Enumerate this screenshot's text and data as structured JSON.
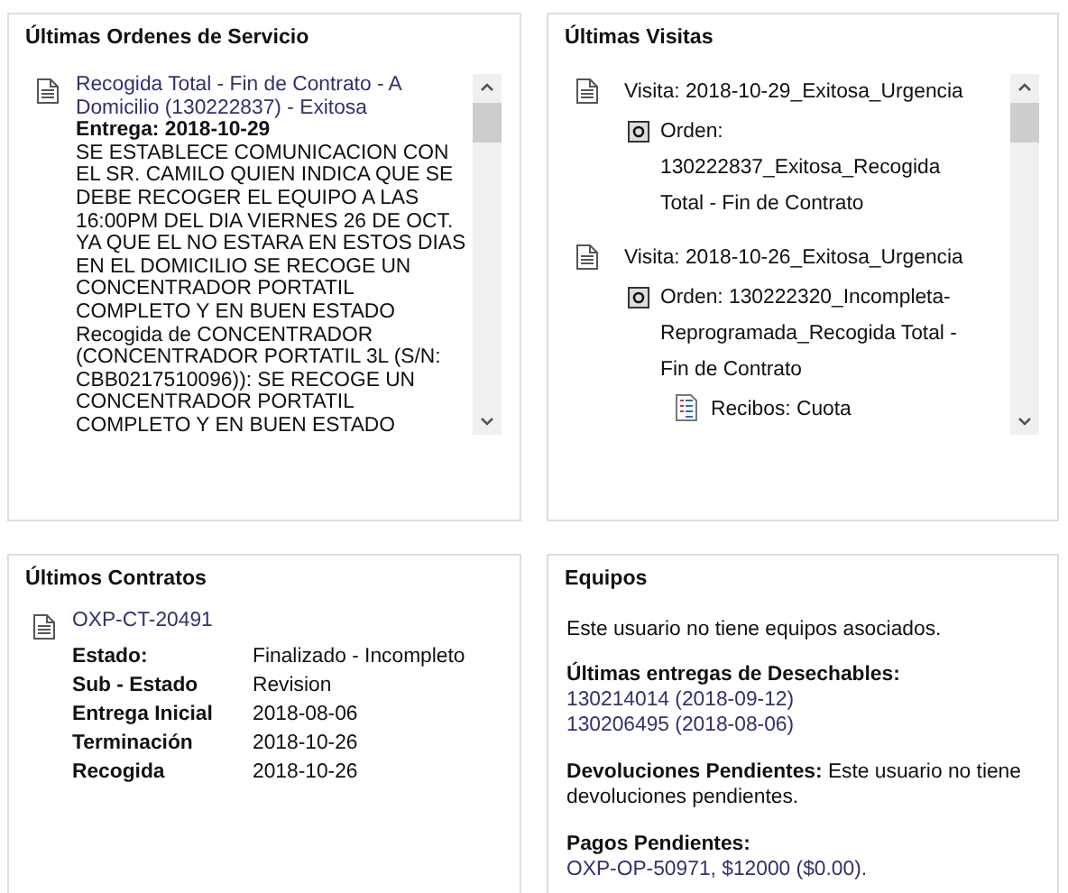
{
  "orders_panel": {
    "title": "Últimas Ordenes de Servicio",
    "orders": [
      {
        "title": "Recogida Total - Fin de Contrato - A Domicilio (130222837) - Exitosa",
        "delivery": "Entrega: 2018-10-29",
        "description": "SE ESTABLECE COMUNICACION CON EL SR. CAMILO QUIEN INDICA QUE SE DEBE RECOGER EL EQUIPO A LAS 16:00PM DEL DIA VIERNES 26 DE OCT. YA QUE EL NO ESTARA EN ESTOS DIAS EN EL DOMICILIO SE RECOGE UN CONCENTRADOR PORTATIL COMPLETO Y EN BUEN ESTADO Recogida de CONCENTRADOR (CONCENTRADOR PORTATIL 3L (S/N: CBB0217510096)): SE RECOGE UN CONCENTRADOR PORTATIL COMPLETO Y EN BUEN ESTADO"
      }
    ]
  },
  "visits_panel": {
    "title": "Últimas Visitas",
    "visits": [
      {
        "kind": "visit",
        "label": "Visita: 2018-10-29_Exitosa_Urgencia",
        "children": [
          {
            "kind": "order",
            "label": "Orden: 130222837_Exitosa_Recogida Total - Fin de Contrato"
          }
        ]
      },
      {
        "kind": "visit",
        "label": "Visita: 2018-10-26_Exitosa_Urgencia",
        "children": [
          {
            "kind": "order",
            "label": "Orden: 130222320_Incompleta-Reprogramada_Recogida Total - Fin de Contrato",
            "children": [
              {
                "kind": "receipt",
                "label": "Recibos: Cuota"
              }
            ]
          }
        ]
      }
    ]
  },
  "contracts_panel": {
    "title": "Últimos Contratos",
    "contracts": [
      {
        "id": "OXP-CT-20491",
        "fields": [
          {
            "label": "Estado:",
            "value": "Finalizado - Incompleto"
          },
          {
            "label": "Sub - Estado",
            "value": "Revision"
          },
          {
            "label": "Entrega Inicial",
            "value": "2018-08-06"
          },
          {
            "label": "Terminación",
            "value": "2018-10-26"
          },
          {
            "label": "Recogida",
            "value": "2018-10-26"
          }
        ]
      }
    ]
  },
  "equipment_panel": {
    "title": "Equipos",
    "message": "Este usuario no tiene equipos asociados.",
    "sections": [
      {
        "kind": "list",
        "heading": "Últimas entregas de Desechables:",
        "lines": [
          "130214014 (2018-09-12)",
          "130206495 (2018-08-06)"
        ]
      },
      {
        "kind": "inline",
        "text": "**Devoluciones Pendientes:** Este usuario no tiene devoluciones pendientes."
      },
      {
        "kind": "list",
        "heading": "Pagos Pendientes:",
        "lines": [
          "OXP-OP-50971, $12000 ($0.00)."
        ]
      }
    ]
  }
}
